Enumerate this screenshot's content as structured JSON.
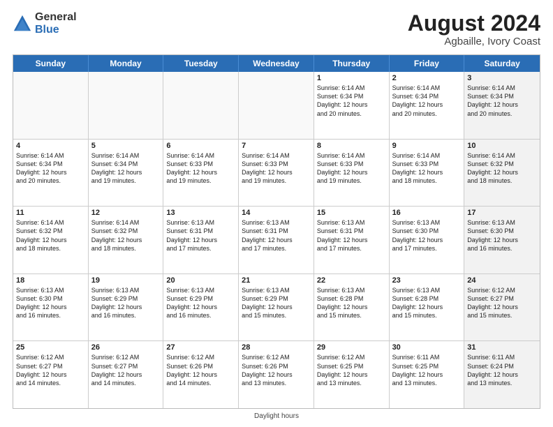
{
  "header": {
    "logo_general": "General",
    "logo_blue": "Blue",
    "title": "August 2024",
    "location": "Agbaille, Ivory Coast"
  },
  "days": [
    "Sunday",
    "Monday",
    "Tuesday",
    "Wednesday",
    "Thursday",
    "Friday",
    "Saturday"
  ],
  "footer": "Daylight hours",
  "weeks": [
    [
      {
        "day": "",
        "empty": true
      },
      {
        "day": "",
        "empty": true
      },
      {
        "day": "",
        "empty": true
      },
      {
        "day": "",
        "empty": true
      },
      {
        "day": "1",
        "lines": [
          "Sunrise: 6:14 AM",
          "Sunset: 6:34 PM",
          "Daylight: 12 hours",
          "and 20 minutes."
        ]
      },
      {
        "day": "2",
        "lines": [
          "Sunrise: 6:14 AM",
          "Sunset: 6:34 PM",
          "Daylight: 12 hours",
          "and 20 minutes."
        ]
      },
      {
        "day": "3",
        "shaded": true,
        "lines": [
          "Sunrise: 6:14 AM",
          "Sunset: 6:34 PM",
          "Daylight: 12 hours",
          "and 20 minutes."
        ]
      }
    ],
    [
      {
        "day": "4",
        "lines": [
          "Sunrise: 6:14 AM",
          "Sunset: 6:34 PM",
          "Daylight: 12 hours",
          "and 20 minutes."
        ]
      },
      {
        "day": "5",
        "lines": [
          "Sunrise: 6:14 AM",
          "Sunset: 6:34 PM",
          "Daylight: 12 hours",
          "and 19 minutes."
        ]
      },
      {
        "day": "6",
        "lines": [
          "Sunrise: 6:14 AM",
          "Sunset: 6:33 PM",
          "Daylight: 12 hours",
          "and 19 minutes."
        ]
      },
      {
        "day": "7",
        "lines": [
          "Sunrise: 6:14 AM",
          "Sunset: 6:33 PM",
          "Daylight: 12 hours",
          "and 19 minutes."
        ]
      },
      {
        "day": "8",
        "lines": [
          "Sunrise: 6:14 AM",
          "Sunset: 6:33 PM",
          "Daylight: 12 hours",
          "and 19 minutes."
        ]
      },
      {
        "day": "9",
        "lines": [
          "Sunrise: 6:14 AM",
          "Sunset: 6:33 PM",
          "Daylight: 12 hours",
          "and 18 minutes."
        ]
      },
      {
        "day": "10",
        "shaded": true,
        "lines": [
          "Sunrise: 6:14 AM",
          "Sunset: 6:32 PM",
          "Daylight: 12 hours",
          "and 18 minutes."
        ]
      }
    ],
    [
      {
        "day": "11",
        "lines": [
          "Sunrise: 6:14 AM",
          "Sunset: 6:32 PM",
          "Daylight: 12 hours",
          "and 18 minutes."
        ]
      },
      {
        "day": "12",
        "lines": [
          "Sunrise: 6:14 AM",
          "Sunset: 6:32 PM",
          "Daylight: 12 hours",
          "and 18 minutes."
        ]
      },
      {
        "day": "13",
        "lines": [
          "Sunrise: 6:13 AM",
          "Sunset: 6:31 PM",
          "Daylight: 12 hours",
          "and 17 minutes."
        ]
      },
      {
        "day": "14",
        "lines": [
          "Sunrise: 6:13 AM",
          "Sunset: 6:31 PM",
          "Daylight: 12 hours",
          "and 17 minutes."
        ]
      },
      {
        "day": "15",
        "lines": [
          "Sunrise: 6:13 AM",
          "Sunset: 6:31 PM",
          "Daylight: 12 hours",
          "and 17 minutes."
        ]
      },
      {
        "day": "16",
        "lines": [
          "Sunrise: 6:13 AM",
          "Sunset: 6:30 PM",
          "Daylight: 12 hours",
          "and 17 minutes."
        ]
      },
      {
        "day": "17",
        "shaded": true,
        "lines": [
          "Sunrise: 6:13 AM",
          "Sunset: 6:30 PM",
          "Daylight: 12 hours",
          "and 16 minutes."
        ]
      }
    ],
    [
      {
        "day": "18",
        "lines": [
          "Sunrise: 6:13 AM",
          "Sunset: 6:30 PM",
          "Daylight: 12 hours",
          "and 16 minutes."
        ]
      },
      {
        "day": "19",
        "lines": [
          "Sunrise: 6:13 AM",
          "Sunset: 6:29 PM",
          "Daylight: 12 hours",
          "and 16 minutes."
        ]
      },
      {
        "day": "20",
        "lines": [
          "Sunrise: 6:13 AM",
          "Sunset: 6:29 PM",
          "Daylight: 12 hours",
          "and 16 minutes."
        ]
      },
      {
        "day": "21",
        "lines": [
          "Sunrise: 6:13 AM",
          "Sunset: 6:29 PM",
          "Daylight: 12 hours",
          "and 15 minutes."
        ]
      },
      {
        "day": "22",
        "lines": [
          "Sunrise: 6:13 AM",
          "Sunset: 6:28 PM",
          "Daylight: 12 hours",
          "and 15 minutes."
        ]
      },
      {
        "day": "23",
        "lines": [
          "Sunrise: 6:13 AM",
          "Sunset: 6:28 PM",
          "Daylight: 12 hours",
          "and 15 minutes."
        ]
      },
      {
        "day": "24",
        "shaded": true,
        "lines": [
          "Sunrise: 6:12 AM",
          "Sunset: 6:27 PM",
          "Daylight: 12 hours",
          "and 15 minutes."
        ]
      }
    ],
    [
      {
        "day": "25",
        "lines": [
          "Sunrise: 6:12 AM",
          "Sunset: 6:27 PM",
          "Daylight: 12 hours",
          "and 14 minutes."
        ]
      },
      {
        "day": "26",
        "lines": [
          "Sunrise: 6:12 AM",
          "Sunset: 6:27 PM",
          "Daylight: 12 hours",
          "and 14 minutes."
        ]
      },
      {
        "day": "27",
        "lines": [
          "Sunrise: 6:12 AM",
          "Sunset: 6:26 PM",
          "Daylight: 12 hours",
          "and 14 minutes."
        ]
      },
      {
        "day": "28",
        "lines": [
          "Sunrise: 6:12 AM",
          "Sunset: 6:26 PM",
          "Daylight: 12 hours",
          "and 13 minutes."
        ]
      },
      {
        "day": "29",
        "lines": [
          "Sunrise: 6:12 AM",
          "Sunset: 6:25 PM",
          "Daylight: 12 hours",
          "and 13 minutes."
        ]
      },
      {
        "day": "30",
        "lines": [
          "Sunrise: 6:11 AM",
          "Sunset: 6:25 PM",
          "Daylight: 12 hours",
          "and 13 minutes."
        ]
      },
      {
        "day": "31",
        "shaded": true,
        "lines": [
          "Sunrise: 6:11 AM",
          "Sunset: 6:24 PM",
          "Daylight: 12 hours",
          "and 13 minutes."
        ]
      }
    ]
  ]
}
